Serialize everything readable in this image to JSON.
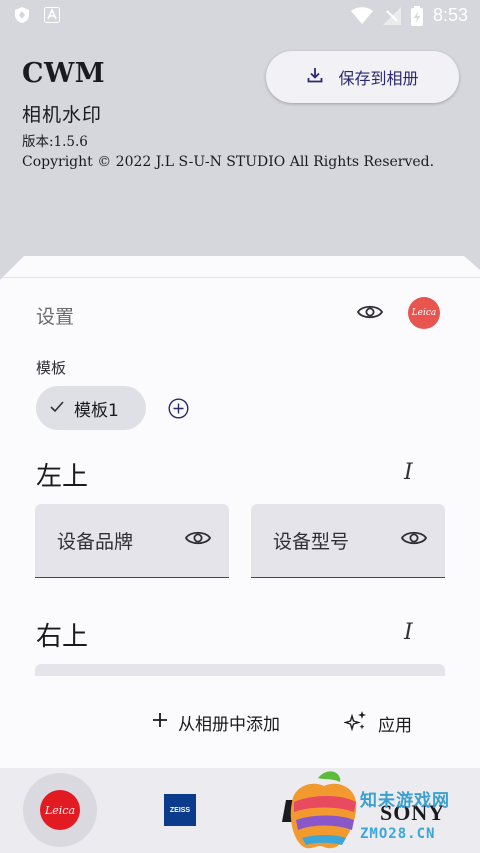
{
  "status_bar": {
    "time": "8:53"
  },
  "header": {
    "title": "CWM",
    "subtitle": "相机水印",
    "version": "版本:1.5.6",
    "copyright": "Copyright © 2022 J.L S-U-N STUDIO All Rights Reserved."
  },
  "save_button": {
    "label": "保存到相册",
    "icon": "download-icon"
  },
  "settings": {
    "title": "设置",
    "brand_badge": "Leica",
    "template_label": "模板",
    "template_chip": "模板1"
  },
  "sections": [
    {
      "title": "左上",
      "italic_button": "I",
      "fields": [
        {
          "label": "设备品牌"
        },
        {
          "label": "设备型号"
        }
      ]
    },
    {
      "title": "右上",
      "italic_button": "I"
    }
  ],
  "actions": {
    "add_from_album": "从相册中添加",
    "apply": "应用"
  },
  "brands": {
    "leica": "Leica",
    "zeiss": "ZEISS",
    "sony": "SONY"
  },
  "watermark": {
    "line1": "知未游戏网",
    "line2": "ZMO28.CN"
  },
  "colors": {
    "background": "#d6d7dc",
    "card": "#fbfbfe",
    "accent": "#2b2a6e",
    "leica_red": "#e21b23"
  }
}
